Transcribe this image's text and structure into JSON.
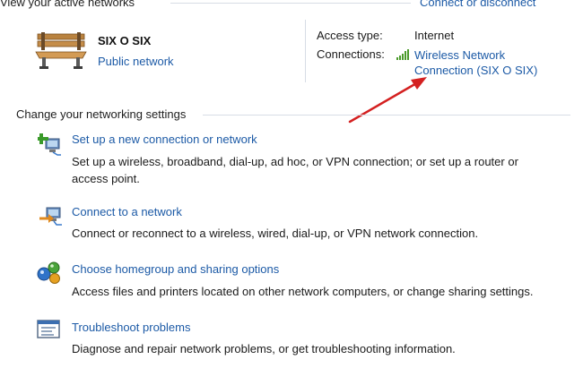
{
  "active_networks": {
    "header": "View your active networks",
    "connect_link": "Connect or disconnect",
    "network": {
      "name": "SIX O SIX",
      "type_link": "Public network",
      "icon": "park-bench-icon"
    },
    "details": {
      "access_type_label": "Access type:",
      "access_type_value": "Internet",
      "connections_label": "Connections:",
      "connection_icon": "signal-bars-icon",
      "connection_link_line1": "Wireless Network",
      "connection_link_line2": "Connection (SIX O SIX)"
    }
  },
  "settings": {
    "header": "Change your networking settings",
    "tasks": [
      {
        "icon": "new-connection-icon",
        "link": "Set up a new connection or network",
        "desc_line1": "Set up a wireless, broadband, dial-up, ad hoc, or VPN connection; or set up a router or",
        "desc_line2": "access point."
      },
      {
        "icon": "connect-network-icon",
        "link": "Connect to a network",
        "desc_line1": "Connect or reconnect to a wireless, wired, dial-up, or VPN network connection."
      },
      {
        "icon": "homegroup-icon",
        "link": "Choose homegroup and sharing options",
        "desc_line1": "Access files and printers located on other network computers, or change sharing settings."
      },
      {
        "icon": "troubleshoot-icon",
        "link": "Troubleshoot problems",
        "desc_line1": "Diagnose and repair network problems, or get troubleshooting information."
      }
    ]
  },
  "colors": {
    "link": "#1c5aa6",
    "annotation_arrow": "#d42020"
  }
}
